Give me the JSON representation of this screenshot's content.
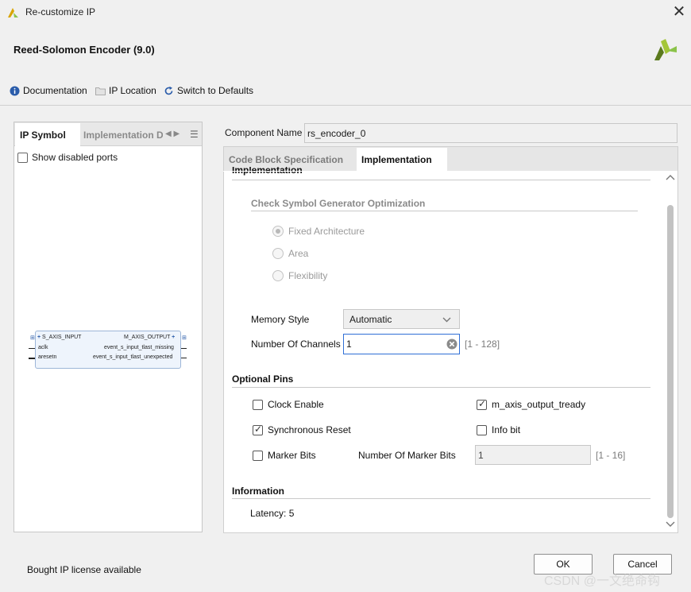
{
  "window": {
    "title": "Re-customize IP",
    "close_icon": "close-icon"
  },
  "header": {
    "ip_title": "Reed-Solomon Encoder (9.0)"
  },
  "toolbar": {
    "documentation": "Documentation",
    "ip_location": "IP Location",
    "switch_defaults": "Switch to Defaults"
  },
  "left_panel": {
    "tabs": [
      "IP Symbol",
      "Implementation D"
    ],
    "show_disabled_ports": "Show disabled ports",
    "symbol": {
      "left_ports": [
        "S_AXIS_INPUT",
        "aclk",
        "aresetn"
      ],
      "right_ports": [
        "M_AXIS_OUTPUT",
        "event_s_input_tlast_missing",
        "event_s_input_tlast_unexpected"
      ]
    }
  },
  "component": {
    "label": "Component Name",
    "value": "rs_encoder_0"
  },
  "tabs": [
    "Code Block Specification",
    "Implementation"
  ],
  "implementation": {
    "section_title": "Implementation",
    "check_symbol_title": "Check Symbol Generator Optimization",
    "radios": [
      {
        "label": "Fixed Architecture",
        "selected": true
      },
      {
        "label": "Area",
        "selected": false
      },
      {
        "label": "Flexibility",
        "selected": false
      }
    ],
    "memory_style_label": "Memory Style",
    "memory_style_value": "Automatic",
    "channels_label": "Number Of Channels",
    "channels_value": "1",
    "channels_range": "[1 - 128]"
  },
  "optional_pins": {
    "title": "Optional Pins",
    "clock_enable": {
      "label": "Clock Enable",
      "checked": false
    },
    "m_axis_output_tready": {
      "label": "m_axis_output_tready",
      "checked": true
    },
    "synchronous_reset": {
      "label": "Synchronous Reset",
      "checked": true
    },
    "info_bit": {
      "label": "Info bit",
      "checked": false
    },
    "marker_bits": {
      "label": "Marker Bits",
      "checked": false
    },
    "marker_bits_count_label": "Number Of Marker Bits",
    "marker_bits_count_value": "1",
    "marker_bits_range": "[1 - 16]"
  },
  "information": {
    "title": "Information",
    "latency": "Latency: 5"
  },
  "footer": {
    "license": "Bought IP license available",
    "ok": "OK",
    "cancel": "Cancel",
    "watermark": "CSDN @一文绝命钩"
  },
  "colors": {
    "accent": "#2f6fd6",
    "logo_green": "#8bc34a",
    "logo_dark": "#5b7a1d"
  }
}
